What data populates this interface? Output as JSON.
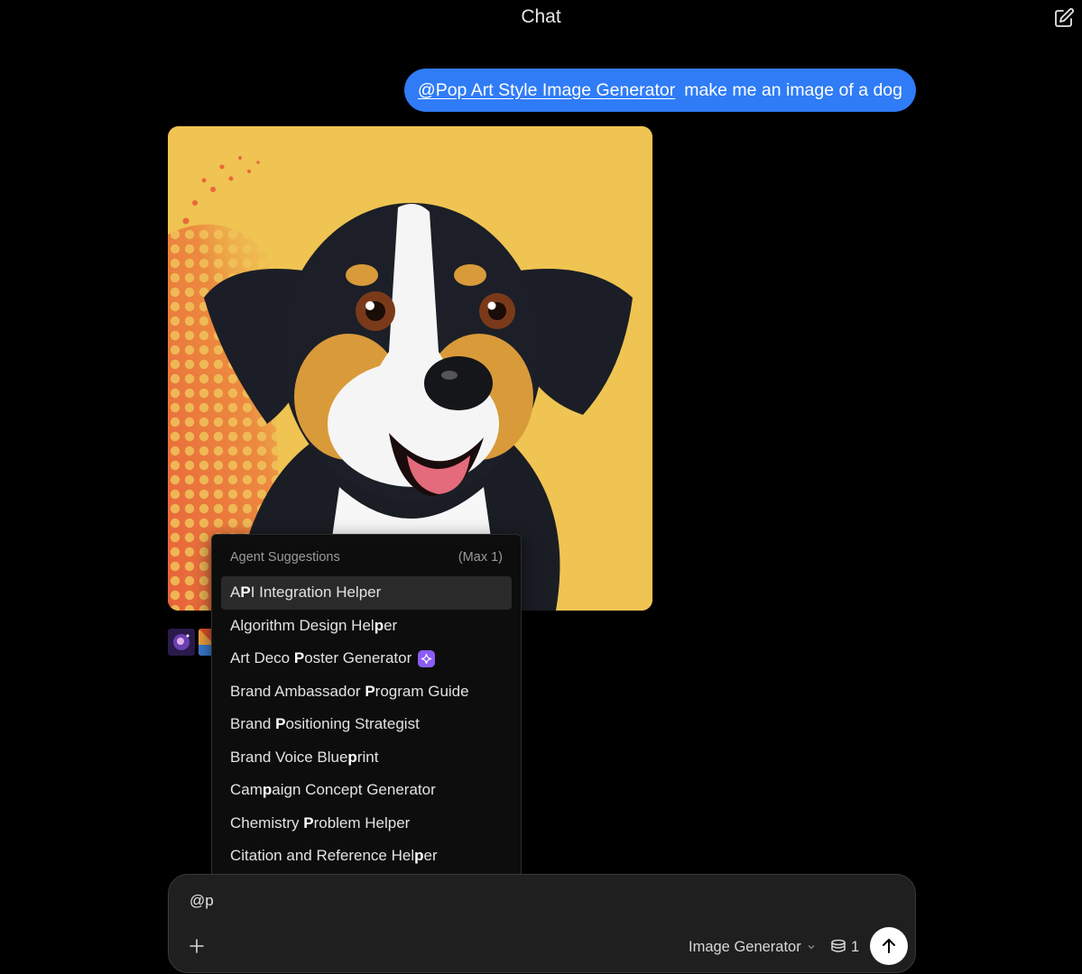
{
  "header": {
    "title": "Chat"
  },
  "icons": {
    "new_chat": "edit-square-icon",
    "plus": "plus-icon",
    "chevron": "chevron-down-icon",
    "credits": "coin-stack-icon",
    "send": "arrow-up-icon",
    "agent_badge": "sparkle-icon"
  },
  "message": {
    "mention": "@Pop Art Style Image Generator",
    "text": "make me an image of a dog"
  },
  "suggestions": {
    "header": "Agent Suggestions",
    "max_label": "(Max 1)",
    "items": [
      {
        "pre": "A",
        "bold": "P",
        "post": "I Integration Helper",
        "active": true,
        "badge": false
      },
      {
        "pre": "Algorithm Design Hel",
        "bold": "p",
        "post": "er",
        "active": false,
        "badge": false
      },
      {
        "pre": "Art Deco ",
        "bold": "P",
        "post": "oster Generator",
        "active": false,
        "badge": true
      },
      {
        "pre": "Brand Ambassador ",
        "bold": "P",
        "post": "rogram Guide",
        "active": false,
        "badge": false
      },
      {
        "pre": "Brand ",
        "bold": "P",
        "post": "ositioning Strategist",
        "active": false,
        "badge": false
      },
      {
        "pre": "Brand Voice Blue",
        "bold": "p",
        "post": "rint",
        "active": false,
        "badge": false
      },
      {
        "pre": "Cam",
        "bold": "p",
        "post": "aign Concept Generator",
        "active": false,
        "badge": false
      },
      {
        "pre": "Chemistry ",
        "bold": "P",
        "post": "roblem Helper",
        "active": false,
        "badge": false
      },
      {
        "pre": "Citation and Reference Hel",
        "bold": "p",
        "post": "er",
        "active": false,
        "badge": false
      }
    ]
  },
  "composer": {
    "value": "@p",
    "model": "Image Generator",
    "credits": "1"
  },
  "colors": {
    "accent": "#2f7cf6",
    "badge": "#8b5cf6",
    "image_bg": "#efc452"
  }
}
